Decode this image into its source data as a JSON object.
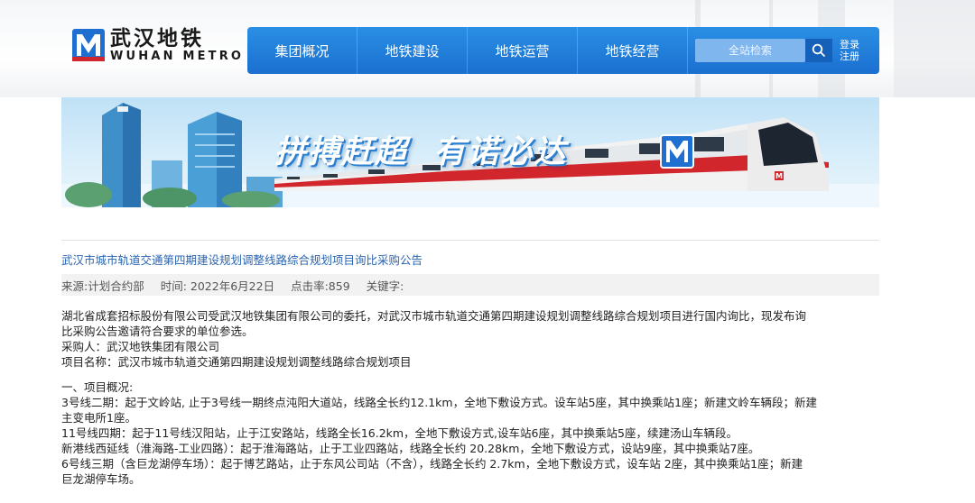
{
  "logo": {
    "cn": "武汉地铁",
    "en": "WUHAN METRO",
    "mark_letter": "M"
  },
  "nav": {
    "items": [
      "集团概况",
      "地铁建设",
      "地铁运营",
      "地铁经营"
    ],
    "search_placeholder": "全站检索",
    "login": "登录",
    "register": "注册"
  },
  "banner": {
    "slogan_1": "拼搏赶超",
    "slogan_2": "有诺必达"
  },
  "article": {
    "title": "武汉市城市轨道交通第四期建设规划调整线路综合规划项目询比采购公告",
    "meta": {
      "source": "来源:计划合约部",
      "time": "时间: 2022年6月22日",
      "clicks": "点击率:859",
      "keywords": "关键字:"
    },
    "paragraphs": [
      "湖北省成套招标股份有限公司受武汉地铁集团有限公司的委托，对武汉市城市轨道交通第四期建设规划调整线路综合规划项目进行国内询比，现发布询",
      "比采购公告邀请符合要求的单位参选。",
      "采购人：武汉地铁集团有限公司",
      "项目名称：武汉市城市轨道交通第四期建设规划调整线路综合规划项目"
    ],
    "section_lines": [
      "一、项目概况:",
      "3号线二期：起于文岭站, 止于3号线一期终点沌阳大道站，线路全长约12.1km，全地下敷设方式。设车站5座，其中换乘站1座；新建文岭车辆段；新建",
      "主变电所1座。",
      "11号线四期：起于11号线汉阳站，止于江安路站，线路全长16.2km，全地下敷设方式,设车站6座，其中换乘站5座，续建汤山车辆段。",
      "新港线西延线（淮海路-工业四路）：起于淮海路站，止于工业四路站，线路全长约 20.28km，全地下敷设方式，设站9座，其中换乘站7座。",
      "6号线三期（含巨龙湖停车场）：起于博艺路站，止于东风公司站（不含），线路全长约 2.7km，全地下敷设方式，设车站 2座，其中换乘站1座；新建",
      "巨龙湖停车场。"
    ]
  },
  "colors": {
    "nav_blue": "#1f7ad8",
    "link_blue": "#2a64b0",
    "brand_red": "#d0262c"
  }
}
